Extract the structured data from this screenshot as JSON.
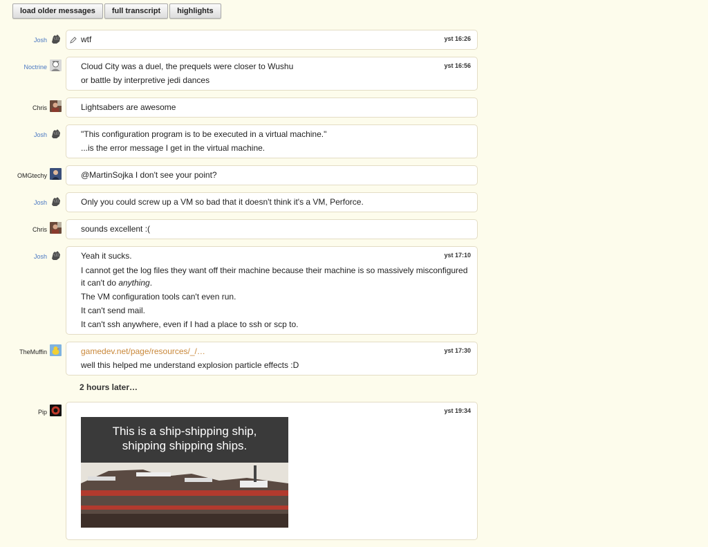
{
  "toolbar": {
    "load_older": "load older messages",
    "full_transcript": "full transcript",
    "highlights": "highlights"
  },
  "messages": [
    {
      "user": "Josh",
      "owner": true,
      "avatar": "hand-avatar",
      "time": "yst 16:26",
      "edited": true,
      "lines": [
        "wtf"
      ]
    },
    {
      "user": "Noctrine",
      "owner": true,
      "avatar": "sketch-avatar",
      "time": "yst 16:56",
      "lines": [
        "Cloud City was a duel, the prequels were closer to Wushu",
        "or battle by interpretive jedi dances"
      ]
    },
    {
      "user": "Chris",
      "owner": false,
      "avatar": "photo-avatar",
      "lines": [
        "Lightsabers are awesome"
      ]
    },
    {
      "user": "Josh",
      "owner": true,
      "avatar": "hand-avatar",
      "lines": [
        "\"This configuration program is to be executed in a virtual machine.\"",
        "...is the error message I get in the virtual machine."
      ]
    },
    {
      "user": "OMGtechy",
      "owner": false,
      "avatar": "portrait-avatar",
      "lines": [
        "@MartinSojka I don't see your point?"
      ]
    },
    {
      "user": "Josh",
      "owner": true,
      "avatar": "hand-avatar",
      "lines": [
        "Only you could screw up a VM so bad that it doesn't think it's a VM, Perforce."
      ]
    },
    {
      "user": "Chris",
      "owner": false,
      "avatar": "photo-avatar",
      "lines": [
        "sounds excellent :("
      ]
    },
    {
      "user": "Josh",
      "owner": true,
      "avatar": "hand-avatar",
      "time": "yst 17:10",
      "lines": [
        "Yeah it sucks."
      ],
      "wrapped": {
        "before": "I cannot get the log files they want off their machine because their machine is so massively misconfigured it can't do ",
        "em": "anything",
        "after": "."
      },
      "more_lines": [
        "The VM configuration tools can't even run.",
        "It can't send mail.",
        "It can't ssh anywhere, even if I had a place to ssh or scp to."
      ]
    },
    {
      "user": "TheMuffin",
      "owner": false,
      "avatar": "duck-avatar",
      "time": "yst 17:30",
      "link": "gamedev.net/page/resources/_/…",
      "lines": [
        "well this helped me understand explosion particle effects :D"
      ]
    }
  ],
  "gap_note": "2 hours later…",
  "last_message": {
    "user": "Pip",
    "avatar": "red-avatar",
    "time": "yst 19:34",
    "image_caption_1": "This is a ship-shipping ship,",
    "image_caption_2": "shipping shipping ships."
  },
  "colors": {
    "background": "#fdfcec",
    "owner_name": "#4a78c2",
    "link": "#c9883a",
    "bubble_border": "#e3dcc4"
  }
}
